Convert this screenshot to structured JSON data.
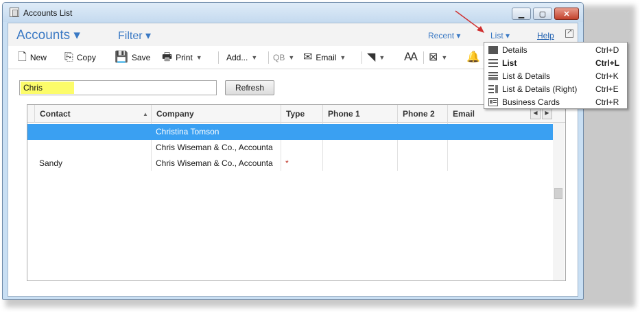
{
  "window": {
    "title": "Accounts List"
  },
  "nav": {
    "accounts": "Accounts ▾",
    "filter": "Filter ▾",
    "recent": "Recent ▾",
    "list": "List ▾",
    "help": "Help"
  },
  "toolbar": {
    "new": "New",
    "copy": "Copy",
    "save": "Save",
    "print": "Print",
    "add": "Add...",
    "qb": "QB",
    "email": "Email"
  },
  "search": {
    "value": "Chris",
    "refresh_label": "Refresh"
  },
  "grid": {
    "columns": [
      "Contact",
      "Company",
      "Type",
      "Phone 1",
      "Phone 2",
      "Email"
    ],
    "rows": [
      {
        "contact": "",
        "company": "Christina Tomson",
        "type": "",
        "selected": true
      },
      {
        "contact": "",
        "company": "Chris Wiseman & Co., Accounta",
        "type": ""
      },
      {
        "contact": "Sandy",
        "company": "Chris Wiseman & Co., Accounta",
        "type": "*"
      }
    ]
  },
  "view_menu": {
    "items": [
      {
        "label": "Details",
        "shortcut": "Ctrl+D"
      },
      {
        "label": "List",
        "shortcut": "Ctrl+L",
        "active": true
      },
      {
        "label": "List & Details",
        "shortcut": "Ctrl+K"
      },
      {
        "label": "List & Details (Right)",
        "shortcut": "Ctrl+E"
      },
      {
        "label": "Business Cards",
        "shortcut": "Ctrl+R"
      }
    ]
  },
  "colors": {
    "accent": "#3a79c4",
    "selection": "#3aa0f2",
    "highlight": "#fcfc6a"
  }
}
